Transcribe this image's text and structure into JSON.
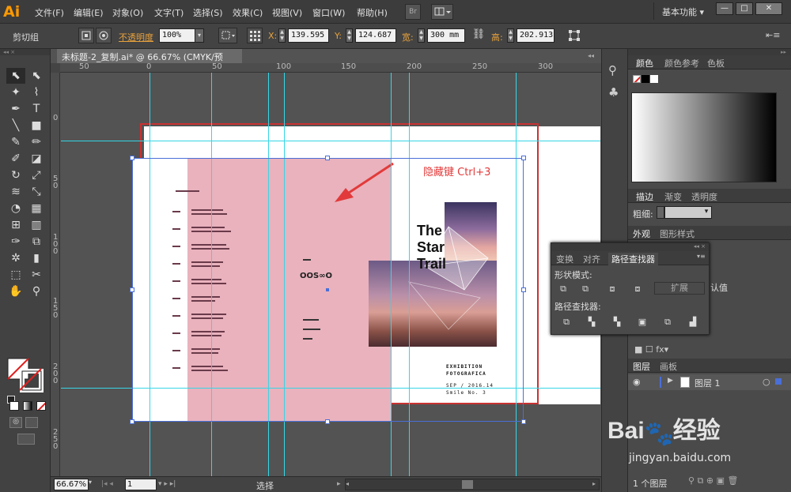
{
  "app": {
    "logo": "Ai",
    "workspace": "基本功能"
  },
  "menu": [
    "文件(F)",
    "编辑(E)",
    "对象(O)",
    "文字(T)",
    "选择(S)",
    "效果(C)",
    "视图(V)",
    "窗口(W)",
    "帮助(H)"
  ],
  "menu_buttons": {
    "bridge": "Br"
  },
  "window_controls": {
    "minimize": "—",
    "restore": "□",
    "close": "✕"
  },
  "control": {
    "selection": "剪切组",
    "opacity_label": "不透明度",
    "opacity_value": "100%",
    "x_label": "X:",
    "x_value": "139.595",
    "y_label": "Y:",
    "y_value": "124.687",
    "w_label": "宽:",
    "w_value": "300 mm",
    "h_label": "高:",
    "h_value": "202.913"
  },
  "document": {
    "tab_title": "未标题-2_复制.ai* @ 66.67% (CMYK/预览)",
    "tab_close": "×"
  },
  "rulers": {
    "top": [
      "50",
      "0",
      "50",
      "100",
      "150",
      "200",
      "250",
      "300"
    ],
    "left": [
      "0",
      "50",
      "100",
      "150",
      "200",
      "250"
    ]
  },
  "artboard": {
    "annotation": "隐藏键 Ctrl+3",
    "poster_title": [
      "The",
      "Star",
      "Trail"
    ],
    "footer_text": [
      "EXHIBITION",
      "FOTOGRAFICA"
    ],
    "footer_small": [
      "SEP / 2016.14",
      "Smile No. 3"
    ]
  },
  "tools": [
    "selection-tool",
    "direct-selection-tool",
    "magic-wand-tool",
    "lasso-tool",
    "pen-tool",
    "type-tool",
    "line-tool",
    "rectangle-tool",
    "paintbrush-tool",
    "pencil-tool",
    "blob-brush-tool",
    "eraser-tool",
    "rotate-tool",
    "scale-tool",
    "width-tool",
    "free-transform-tool",
    "shape-builder-tool",
    "perspective-grid-tool",
    "mesh-tool",
    "gradient-tool",
    "eyedropper-tool",
    "blend-tool",
    "symbol-sprayer-tool",
    "column-graph-tool",
    "artboard-tool",
    "slice-tool",
    "hand-tool",
    "zoom-tool"
  ],
  "status": {
    "zoom": "66.67%",
    "page": "1",
    "mode": "选择"
  },
  "panels": {
    "color_tabs": [
      "颜色",
      "颜色参考",
      "色板"
    ],
    "stroke_tabs": [
      "描边",
      "渐变",
      "透明度"
    ],
    "stroke_weight_label": "粗细:",
    "appearance_tabs": [
      "外观",
      "图形样式"
    ],
    "appearance_default": "认值",
    "layers_tabs": [
      "图层",
      "画板"
    ],
    "layer_name": "图层 1",
    "layers_count": "1 个图层"
  },
  "pathfinder": {
    "tabs": [
      "变换",
      "对齐",
      "路径查找器"
    ],
    "shape_modes_label": "形状模式:",
    "expand_button": "扩展",
    "pathfinders_label": "路径查找器:"
  },
  "watermark": {
    "brand": "Bai",
    "brand2": "经验",
    "url": "jingyan.baidu.com"
  },
  "colors": {
    "accent_pink": "#e9b2bd",
    "guide_cyan": "#36d6e6",
    "ai_orange": "#ff9a00",
    "annotation_red": "#e23a3a"
  }
}
